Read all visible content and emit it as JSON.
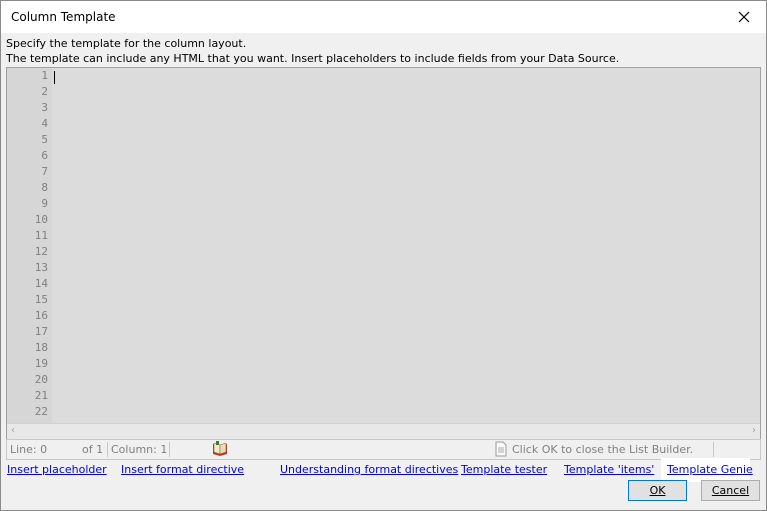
{
  "window": {
    "title": "Column Template"
  },
  "description": {
    "line1": "Specify the template for the column layout.",
    "line2": "The template can include any HTML that you want. Insert placeholders to include fields from your Data Source."
  },
  "editor": {
    "line_numbers": [
      "1",
      "2",
      "3",
      "4",
      "5",
      "6",
      "7",
      "8",
      "9",
      "10",
      "11",
      "12",
      "13",
      "14",
      "15",
      "16",
      "17",
      "18",
      "19",
      "20",
      "21",
      "22"
    ],
    "content": ""
  },
  "status": {
    "line": "Line: 0",
    "of": "of 1",
    "column": "Column: 1",
    "message": "Click OK to close the List Builder."
  },
  "links": [
    "Insert placeholder",
    "Insert format directive",
    "Understanding format directives",
    "Template tester",
    "Template 'items'",
    "Template Genie"
  ],
  "buttons": {
    "ok": "OK",
    "cancel": "Cancel"
  },
  "icons": {
    "close": "close-icon",
    "book": "book-icon",
    "document": "document-icon"
  },
  "colors": {
    "link": "#0000ee",
    "editor_bg": "#dcdcdc",
    "gutter_text": "#808080"
  }
}
